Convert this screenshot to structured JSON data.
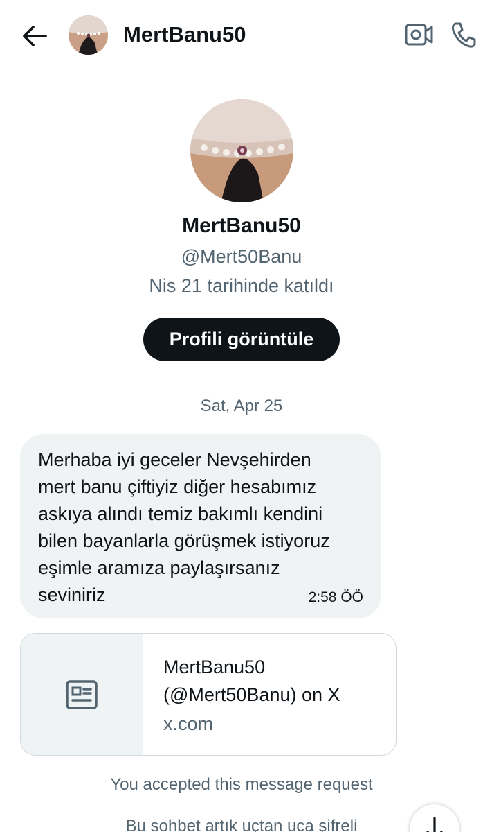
{
  "header": {
    "title": "MertBanu50",
    "back_icon": "arrow-left-icon",
    "video_icon": "video-call-icon",
    "call_icon": "phone-icon"
  },
  "profile": {
    "name": "MertBanu50",
    "handle": "@Mert50Banu",
    "joined": "Nis 21 tarihinde katıldı",
    "view_profile_label": "Profili görüntüle"
  },
  "conversation": {
    "date_separator": "Sat, Apr 25",
    "message": {
      "text": "Merhaba iyi geceler Nevşehirden\nmert banu çiftiyiz diğer hesabımız\naskıya alındı temiz bakımlı kendini\nbilen bayanlarla görüşmek istiyoruz\neşimle aramıza paylaşırsanız\nseviniriz",
      "time": "2:58 ÖÖ"
    },
    "link_card": {
      "title": "MertBanu50 (@Mert50Banu) on X",
      "domain": "x.com",
      "icon": "article-icon"
    },
    "accepted_note": "You accepted this message request",
    "encryption_note": "Bu sohbet artık uçtan uca şifreli"
  },
  "colors": {
    "primary_text": "#0f1419",
    "secondary_text": "#536471",
    "bubble_bg": "#eff3f4",
    "button_bg": "#0f1419"
  }
}
